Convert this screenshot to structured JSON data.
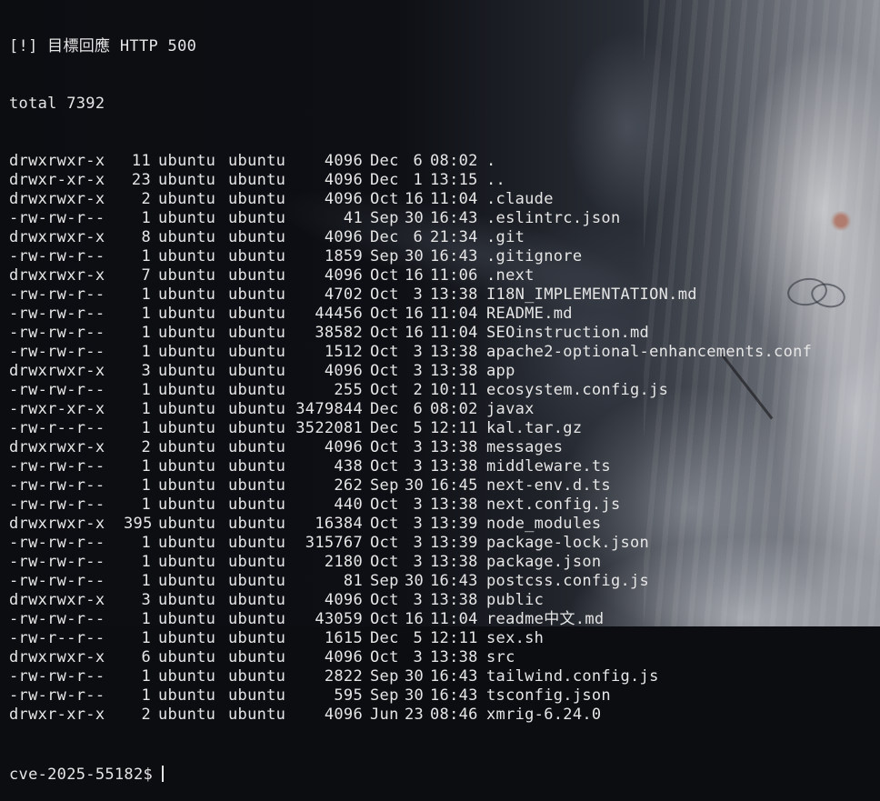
{
  "terminal": {
    "error_line": "[!] 目標回應 HTTP 500",
    "total_line": "total 7392",
    "entries": [
      {
        "perm": "drwxrwxr-x",
        "links": "11",
        "owner": "ubuntu",
        "group": "ubuntu",
        "size": "4096",
        "month": "Dec",
        "day": "6",
        "time": "08:02",
        "name": "."
      },
      {
        "perm": "drwxr-xr-x",
        "links": "23",
        "owner": "ubuntu",
        "group": "ubuntu",
        "size": "4096",
        "month": "Dec",
        "day": "1",
        "time": "13:15",
        "name": ".."
      },
      {
        "perm": "drwxrwxr-x",
        "links": "2",
        "owner": "ubuntu",
        "group": "ubuntu",
        "size": "4096",
        "month": "Oct",
        "day": "16",
        "time": "11:04",
        "name": ".claude"
      },
      {
        "perm": "-rw-rw-r--",
        "links": "1",
        "owner": "ubuntu",
        "group": "ubuntu",
        "size": "41",
        "month": "Sep",
        "day": "30",
        "time": "16:43",
        "name": ".eslintrc.json"
      },
      {
        "perm": "drwxrwxr-x",
        "links": "8",
        "owner": "ubuntu",
        "group": "ubuntu",
        "size": "4096",
        "month": "Dec",
        "day": "6",
        "time": "21:34",
        "name": ".git"
      },
      {
        "perm": "-rw-rw-r--",
        "links": "1",
        "owner": "ubuntu",
        "group": "ubuntu",
        "size": "1859",
        "month": "Sep",
        "day": "30",
        "time": "16:43",
        "name": ".gitignore"
      },
      {
        "perm": "drwxrwxr-x",
        "links": "7",
        "owner": "ubuntu",
        "group": "ubuntu",
        "size": "4096",
        "month": "Oct",
        "day": "16",
        "time": "11:06",
        "name": ".next"
      },
      {
        "perm": "-rw-rw-r--",
        "links": "1",
        "owner": "ubuntu",
        "group": "ubuntu",
        "size": "4702",
        "month": "Oct",
        "day": "3",
        "time": "13:38",
        "name": "I18N_IMPLEMENTATION.md"
      },
      {
        "perm": "-rw-rw-r--",
        "links": "1",
        "owner": "ubuntu",
        "group": "ubuntu",
        "size": "44456",
        "month": "Oct",
        "day": "16",
        "time": "11:04",
        "name": "README.md"
      },
      {
        "perm": "-rw-rw-r--",
        "links": "1",
        "owner": "ubuntu",
        "group": "ubuntu",
        "size": "38582",
        "month": "Oct",
        "day": "16",
        "time": "11:04",
        "name": "SEOinstruction.md"
      },
      {
        "perm": "-rw-rw-r--",
        "links": "1",
        "owner": "ubuntu",
        "group": "ubuntu",
        "size": "1512",
        "month": "Oct",
        "day": "3",
        "time": "13:38",
        "name": "apache2-optional-enhancements.conf"
      },
      {
        "perm": "drwxrwxr-x",
        "links": "3",
        "owner": "ubuntu",
        "group": "ubuntu",
        "size": "4096",
        "month": "Oct",
        "day": "3",
        "time": "13:38",
        "name": "app"
      },
      {
        "perm": "-rw-rw-r--",
        "links": "1",
        "owner": "ubuntu",
        "group": "ubuntu",
        "size": "255",
        "month": "Oct",
        "day": "2",
        "time": "10:11",
        "name": "ecosystem.config.js"
      },
      {
        "perm": "-rwxr-xr-x",
        "links": "1",
        "owner": "ubuntu",
        "group": "ubuntu",
        "size": "3479844",
        "month": "Dec",
        "day": "6",
        "time": "08:02",
        "name": "javax"
      },
      {
        "perm": "-rw-r--r--",
        "links": "1",
        "owner": "ubuntu",
        "group": "ubuntu",
        "size": "3522081",
        "month": "Dec",
        "day": "5",
        "time": "12:11",
        "name": "kal.tar.gz"
      },
      {
        "perm": "drwxrwxr-x",
        "links": "2",
        "owner": "ubuntu",
        "group": "ubuntu",
        "size": "4096",
        "month": "Oct",
        "day": "3",
        "time": "13:38",
        "name": "messages"
      },
      {
        "perm": "-rw-rw-r--",
        "links": "1",
        "owner": "ubuntu",
        "group": "ubuntu",
        "size": "438",
        "month": "Oct",
        "day": "3",
        "time": "13:38",
        "name": "middleware.ts"
      },
      {
        "perm": "-rw-rw-r--",
        "links": "1",
        "owner": "ubuntu",
        "group": "ubuntu",
        "size": "262",
        "month": "Sep",
        "day": "30",
        "time": "16:45",
        "name": "next-env.d.ts"
      },
      {
        "perm": "-rw-rw-r--",
        "links": "1",
        "owner": "ubuntu",
        "group": "ubuntu",
        "size": "440",
        "month": "Oct",
        "day": "3",
        "time": "13:38",
        "name": "next.config.js"
      },
      {
        "perm": "drwxrwxr-x",
        "links": "395",
        "owner": "ubuntu",
        "group": "ubuntu",
        "size": "16384",
        "month": "Oct",
        "day": "3",
        "time": "13:39",
        "name": "node_modules"
      },
      {
        "perm": "-rw-rw-r--",
        "links": "1",
        "owner": "ubuntu",
        "group": "ubuntu",
        "size": "315767",
        "month": "Oct",
        "day": "3",
        "time": "13:39",
        "name": "package-lock.json"
      },
      {
        "perm": "-rw-rw-r--",
        "links": "1",
        "owner": "ubuntu",
        "group": "ubuntu",
        "size": "2180",
        "month": "Oct",
        "day": "3",
        "time": "13:38",
        "name": "package.json"
      },
      {
        "perm": "-rw-rw-r--",
        "links": "1",
        "owner": "ubuntu",
        "group": "ubuntu",
        "size": "81",
        "month": "Sep",
        "day": "30",
        "time": "16:43",
        "name": "postcss.config.js"
      },
      {
        "perm": "drwxrwxr-x",
        "links": "3",
        "owner": "ubuntu",
        "group": "ubuntu",
        "size": "4096",
        "month": "Oct",
        "day": "3",
        "time": "13:38",
        "name": "public"
      },
      {
        "perm": "-rw-rw-r--",
        "links": "1",
        "owner": "ubuntu",
        "group": "ubuntu",
        "size": "43059",
        "month": "Oct",
        "day": "16",
        "time": "11:04",
        "name": "readme中文.md"
      },
      {
        "perm": "-rw-r--r--",
        "links": "1",
        "owner": "ubuntu",
        "group": "ubuntu",
        "size": "1615",
        "month": "Dec",
        "day": "5",
        "time": "12:11",
        "name": "sex.sh"
      },
      {
        "perm": "drwxrwxr-x",
        "links": "6",
        "owner": "ubuntu",
        "group": "ubuntu",
        "size": "4096",
        "month": "Oct",
        "day": "3",
        "time": "13:38",
        "name": "src"
      },
      {
        "perm": "-rw-rw-r--",
        "links": "1",
        "owner": "ubuntu",
        "group": "ubuntu",
        "size": "2822",
        "month": "Sep",
        "day": "30",
        "time": "16:43",
        "name": "tailwind.config.js"
      },
      {
        "perm": "-rw-rw-r--",
        "links": "1",
        "owner": "ubuntu",
        "group": "ubuntu",
        "size": "595",
        "month": "Sep",
        "day": "30",
        "time": "16:43",
        "name": "tsconfig.json"
      },
      {
        "perm": "drwxr-xr-x",
        "links": "2",
        "owner": "ubuntu",
        "group": "ubuntu",
        "size": "4096",
        "month": "Jun",
        "day": "23",
        "time": "08:46",
        "name": "xmrig-6.24.0"
      }
    ],
    "prompt": "cve-2025-55182$",
    "text_color": "#e6e6e6",
    "background_color": "#0b0d11"
  }
}
